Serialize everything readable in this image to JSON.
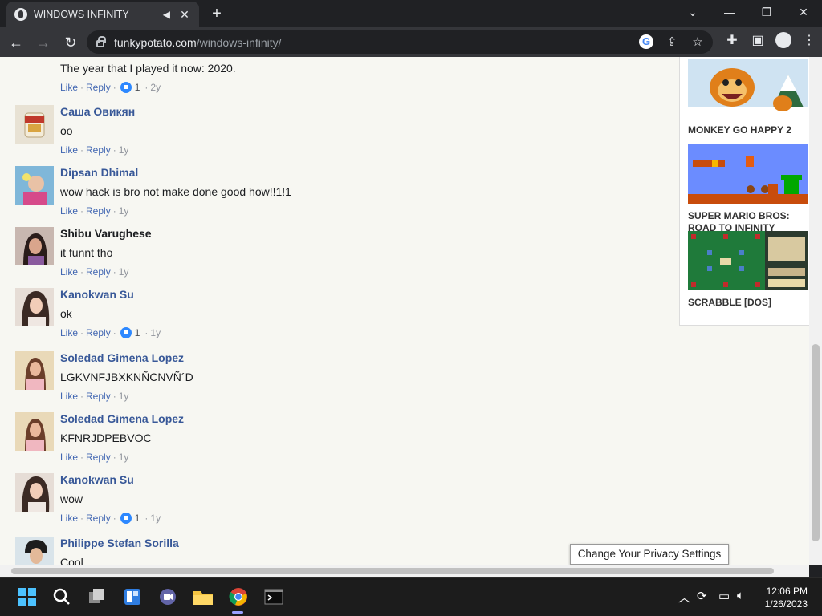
{
  "browser": {
    "tab_title": "WINDOWS INFINITY",
    "tab_close": "✕",
    "new_tab": "+",
    "url_domain": "funkypotato.com",
    "url_path": "/windows-infinity/",
    "window_controls": {
      "tabsearch": "⌄",
      "minimize": "—",
      "restore": "❐",
      "close": "✕"
    }
  },
  "partial_comment": {
    "text": "The year that I played it now: 2020.",
    "like": "Like",
    "reply": "Reply",
    "likes": "1",
    "time": "2y"
  },
  "comments": [
    {
      "author": "Саша Овикян",
      "text": "oo",
      "like": "Like",
      "reply": "Reply",
      "likes": "",
      "time": "1y"
    },
    {
      "author": "Dipsan Dhimal",
      "text": "wow hack is bro not make done good how!!1!1",
      "like": "Like",
      "reply": "Reply",
      "likes": "",
      "time": "1y"
    },
    {
      "author": "Shibu Varughese",
      "text": "it funnt tho",
      "like": "Like",
      "reply": "Reply",
      "likes": "",
      "time": "1y"
    },
    {
      "author": "Kanokwan Su",
      "text": "ok",
      "like": "Like",
      "reply": "Reply",
      "likes": "1",
      "time": "1y"
    },
    {
      "author": "Soledad Gimena Lopez",
      "text": "LGKVNFJBXKNÑCNVÑ´D",
      "like": "Like",
      "reply": "Reply",
      "likes": "",
      "time": "1y"
    },
    {
      "author": "Soledad Gimena Lopez",
      "text": "KFNRJDPEBVOC",
      "like": "Like",
      "reply": "Reply",
      "likes": "",
      "time": "1y"
    },
    {
      "author": "Kanokwan Su",
      "text": "wow",
      "like": "Like",
      "reply": "Reply",
      "likes": "1",
      "time": "1y"
    },
    {
      "author": "Philippe Stefan Sorilla",
      "text": "Cool",
      "like": "",
      "reply": "",
      "likes": "",
      "time": ""
    }
  ],
  "sidebar": {
    "games": [
      {
        "title": "MONKEY GO HAPPY 2"
      },
      {
        "title": "SUPER MARIO BROS: ROAD TO INFINITY"
      },
      {
        "title": "SCRABBLE [DOS]"
      }
    ]
  },
  "privacy_button": "Change Your Privacy Settings",
  "taskbar": {
    "time": "12:06 PM",
    "date": "1/26/2023"
  },
  "colors": {
    "link": "#385898",
    "page_bg": "#f7f7f2",
    "chrome_dark": "#202124",
    "like_blue": "#2d88ff"
  }
}
